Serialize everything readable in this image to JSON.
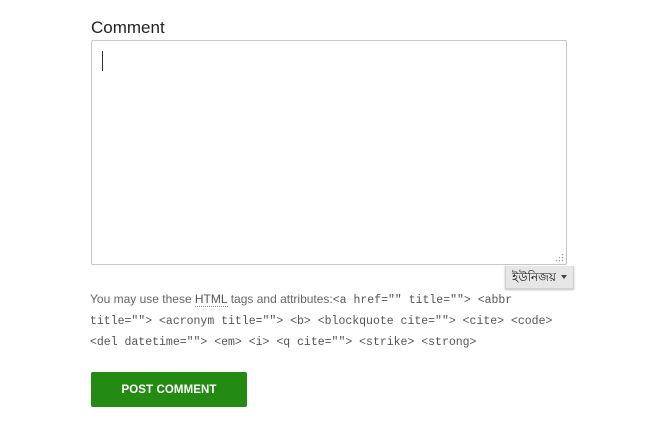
{
  "form": {
    "comment_label": "Comment",
    "comment_value": "",
    "ime_selector": {
      "label": "ইউনিজয়",
      "icon": "chevron-down-icon"
    },
    "allowed_tags": {
      "prefix": "You may use these",
      "html_abbr": "HTML",
      "suffix": "tags and attributes:",
      "code": "<a href=\"\" title=\"\"> <abbr title=\"\"> <acronym title=\"\"> <b> <blockquote cite=\"\"> <cite> <code> <del datetime=\"\"> <em> <i> <q cite=\"\"> <strike> <strong>"
    },
    "submit_label": "POST COMMENT",
    "colors": {
      "submit_bg": "#238a12",
      "submit_text": "#ffffff",
      "border": "#c7c7c7"
    }
  }
}
